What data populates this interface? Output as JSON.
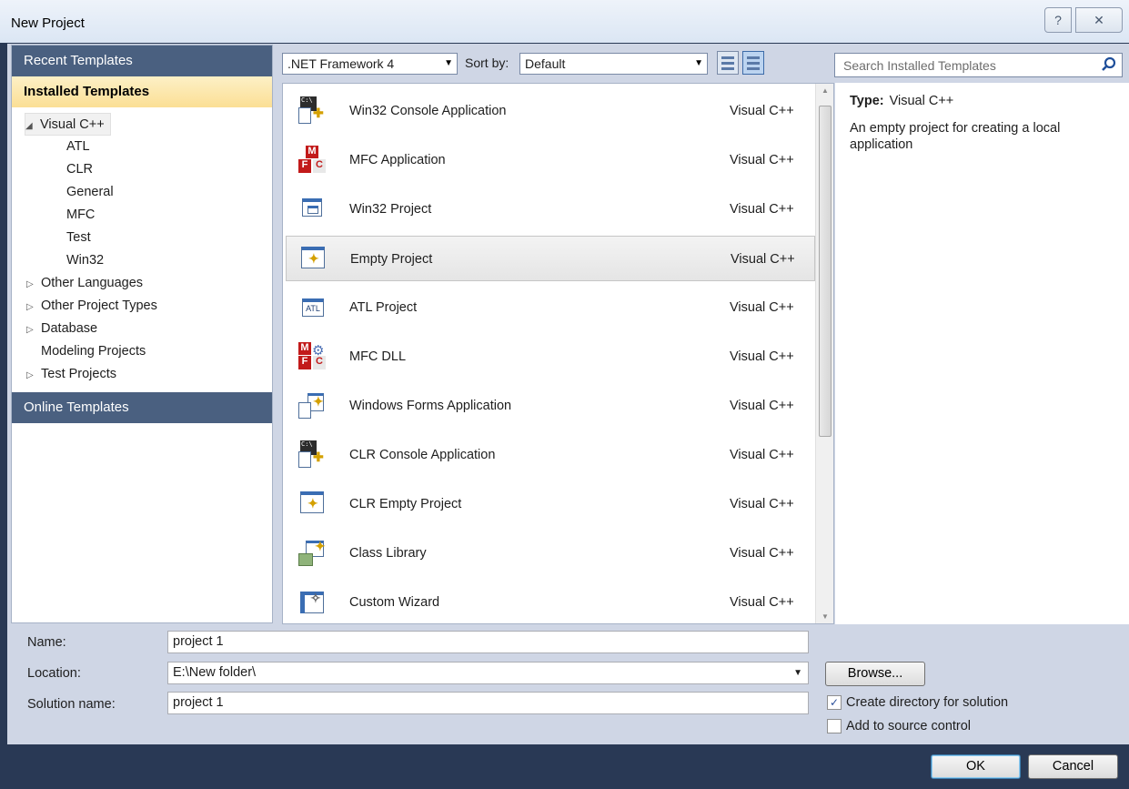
{
  "window": {
    "title": "New Project",
    "help_glyph": "?",
    "close_glyph": "✕"
  },
  "left_pane": {
    "recent_templates": "Recent Templates",
    "installed_templates": "Installed Templates",
    "online_templates": "Online Templates",
    "tree": [
      {
        "label": "Visual C++",
        "expander": "◢",
        "indent": 0,
        "selected": true
      },
      {
        "label": "ATL",
        "expander": "",
        "indent": 1
      },
      {
        "label": "CLR",
        "expander": "",
        "indent": 1
      },
      {
        "label": "General",
        "expander": "",
        "indent": 1
      },
      {
        "label": "MFC",
        "expander": "",
        "indent": 1
      },
      {
        "label": "Test",
        "expander": "",
        "indent": 1
      },
      {
        "label": "Win32",
        "expander": "",
        "indent": 1
      },
      {
        "label": "Other Languages",
        "expander": "▷",
        "indent": 0
      },
      {
        "label": "Other Project Types",
        "expander": "▷",
        "indent": 0
      },
      {
        "label": "Database",
        "expander": "▷",
        "indent": 0
      },
      {
        "label": "Modeling Projects",
        "expander": "",
        "indent": 0
      },
      {
        "label": "Test Projects",
        "expander": "▷",
        "indent": 0
      }
    ]
  },
  "toolbar": {
    "framework": ".NET Framework 4",
    "sort_by_label": "Sort by:",
    "sort_value": "Default",
    "dropdown_glyph": "▼"
  },
  "search": {
    "placeholder": "Search Installed Templates"
  },
  "templates": [
    {
      "name": "Win32 Console Application",
      "lang": "Visual C++",
      "icon": "console-app-icon"
    },
    {
      "name": "MFC Application",
      "lang": "Visual C++",
      "icon": "mfc-app-icon"
    },
    {
      "name": "Win32 Project",
      "lang": "Visual C++",
      "icon": "win32-project-icon"
    },
    {
      "name": "Empty Project",
      "lang": "Visual C++",
      "icon": "empty-project-icon",
      "selected": true
    },
    {
      "name": "ATL Project",
      "lang": "Visual C++",
      "icon": "atl-project-icon"
    },
    {
      "name": "MFC DLL",
      "lang": "Visual C++",
      "icon": "mfc-dll-icon"
    },
    {
      "name": "Windows Forms Application",
      "lang": "Visual C++",
      "icon": "windows-forms-icon"
    },
    {
      "name": "CLR Console Application",
      "lang": "Visual C++",
      "icon": "clr-console-icon"
    },
    {
      "name": "CLR Empty Project",
      "lang": "Visual C++",
      "icon": "clr-empty-icon"
    },
    {
      "name": "Class Library",
      "lang": "Visual C++",
      "icon": "class-library-icon"
    },
    {
      "name": "Custom Wizard",
      "lang": "Visual C++",
      "icon": "custom-wizard-icon"
    }
  ],
  "info": {
    "type_label": "Type:",
    "type_value": "Visual C++",
    "description": "An empty project for creating a local application"
  },
  "form": {
    "name_label": "Name:",
    "name_value": "project 1",
    "location_label": "Location:",
    "location_value": "E:\\New folder\\",
    "solution_label": "Solution name:",
    "solution_value": "project 1",
    "browse": "Browse...",
    "create_dir_label": "Create directory for solution",
    "create_dir_checked": true,
    "source_control_label": "Add to source control",
    "source_control_checked": false,
    "check_glyph": "✓"
  },
  "buttons": {
    "ok": "OK",
    "cancel": "Cancel"
  }
}
